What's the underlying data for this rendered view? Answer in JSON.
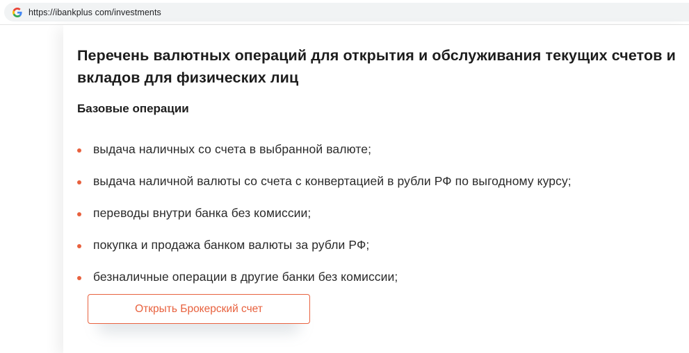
{
  "browser": {
    "url": "https://ibankplus com/investments",
    "icon": "google-g-icon"
  },
  "content": {
    "title": "Перечень валютных операций для открытия и обслуживания текущих счетов и вкладов для физических лиц",
    "subtitle": "Базовые операции",
    "operations": [
      "выдача наличных со счета в выбранной валюте;",
      "выдача наличной валюты со счета с конвертацией в рубли РФ по выгодному курсу;",
      "переводы внутри банка без комиссии;",
      "покупка и продажа банком валюты за рубли РФ;",
      "безналичные операции в другие банки без комиссии;"
    ],
    "button_label": "Открыть Брокерский счет"
  },
  "colors": {
    "accent": "#e8613e",
    "text": "#1d1d1d",
    "address_bar_bg": "#f1f3f4"
  }
}
